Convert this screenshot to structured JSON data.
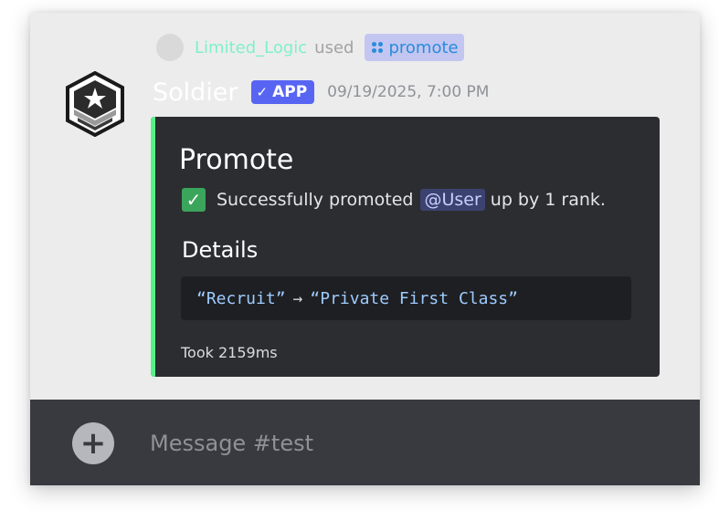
{
  "reply": {
    "username": "Limited_Logic",
    "action": "used",
    "command": "promote"
  },
  "message": {
    "bot_name": "Soldier",
    "badge": "APP",
    "timestamp": "09/19/2025, 7:00 PM"
  },
  "embed": {
    "accent_color": "#57f287",
    "title": "Promote",
    "description_prefix": "Successfully promoted",
    "mention": "@User",
    "description_suffix": "up by 1 rank.",
    "field_name": "Details",
    "from_rank": "“Recruit”",
    "arrow": "→",
    "to_rank": "“Private First Class”",
    "footer": "Took 2159ms"
  },
  "composer": {
    "placeholder": "Message #test",
    "add_icon": "plus-icon"
  },
  "icons": {
    "avatar": "military-rank-insignia-icon",
    "check": "checkmark-icon",
    "command": "slash-command-icon"
  }
}
